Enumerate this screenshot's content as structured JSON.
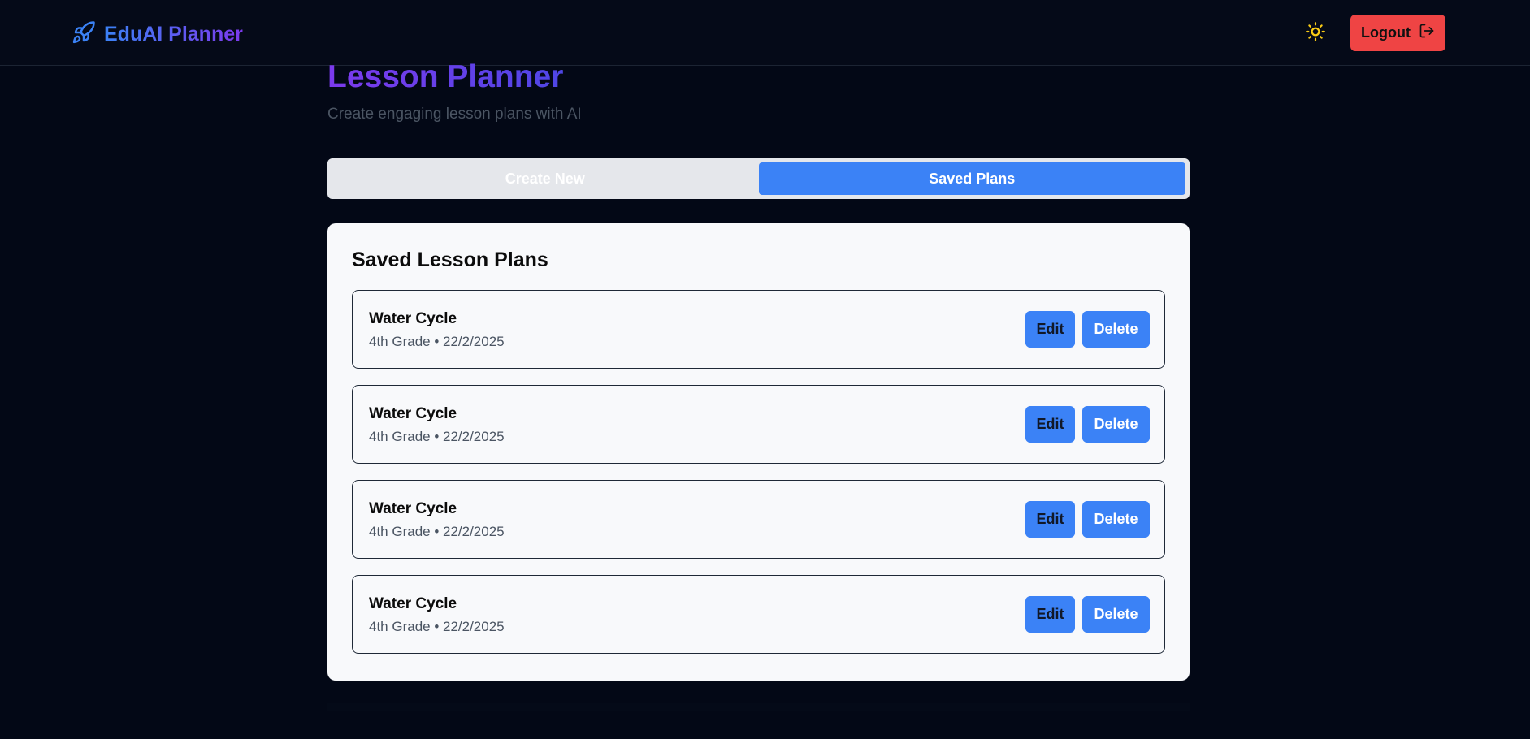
{
  "app": {
    "brand": "EduAI Planner",
    "brand_icon": "rocket-icon",
    "theme_icon": "sun-icon",
    "logout_label": "Logout",
    "logout_icon": "logout-icon"
  },
  "page": {
    "title": "Lesson Planner",
    "subtitle": "Create engaging lesson plans with AI"
  },
  "tabs": [
    {
      "label": "Create New",
      "active": false
    },
    {
      "label": "Saved Plans",
      "active": true
    }
  ],
  "saved": {
    "heading": "Saved Lesson Plans",
    "plans": [
      {
        "title": "Water Cycle",
        "meta": "4th Grade • 22/2/2025",
        "edit_label": "Edit",
        "delete_label": "Delete"
      },
      {
        "title": "Water Cycle",
        "meta": "4th Grade • 22/2/2025",
        "edit_label": "Edit",
        "delete_label": "Delete"
      },
      {
        "title": "Water Cycle",
        "meta": "4th Grade • 22/2/2025",
        "edit_label": "Edit",
        "delete_label": "Delete"
      },
      {
        "title": "Water Cycle",
        "meta": "4th Grade • 22/2/2025",
        "edit_label": "Edit",
        "delete_label": "Delete"
      }
    ]
  },
  "colors": {
    "background": "#030816",
    "accent": "#3b82f6",
    "danger": "#ef4444",
    "brand_gradient_start": "#3b82f6",
    "brand_gradient_end": "#7c3aed",
    "sun": "#facc15"
  }
}
